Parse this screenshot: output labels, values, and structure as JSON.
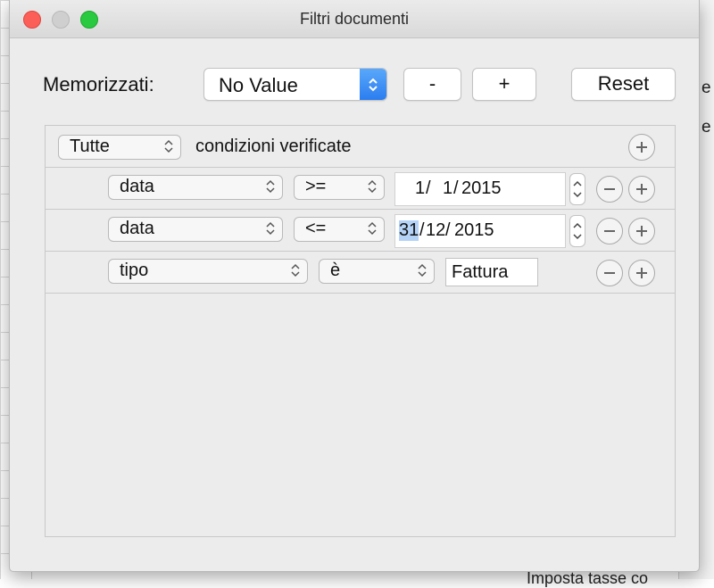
{
  "window": {
    "title": "Filtri documenti"
  },
  "toolbar": {
    "memorized_label": "Memorizzati:",
    "memorized_value": "No Value",
    "minus_label": "-",
    "plus_label": "+",
    "reset_label": "Reset"
  },
  "filter": {
    "match_value": "Tutte",
    "match_suffix": "condizioni verificate",
    "rules": [
      {
        "field": "data",
        "operator": ">=",
        "value_day": "1",
        "value_month": "1",
        "value_year": "2015"
      },
      {
        "field": "data",
        "operator": "<=",
        "value_day": "31",
        "value_month": "12",
        "value_year": "2015"
      },
      {
        "field": "tipo",
        "operator": "è",
        "value": "Fattura"
      }
    ]
  },
  "background": {
    "frag_top": "e",
    "frag_mid": "e",
    "frag_bottom": "Imposta  tasse  co"
  },
  "colors": {
    "accent": "#2b7df0",
    "close": "#fc5f57",
    "maximize": "#29c940",
    "selection": "#b5d3f6"
  }
}
